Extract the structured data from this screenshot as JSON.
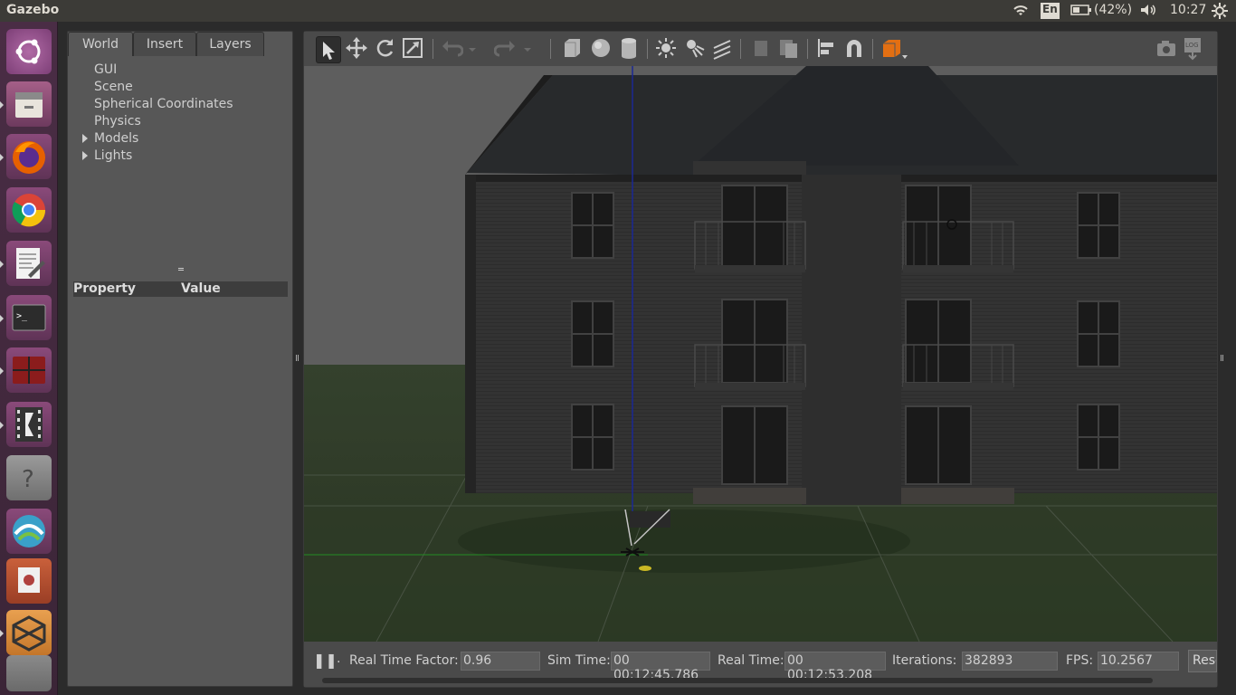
{
  "topbar": {
    "app_title": "Gazebo",
    "keyboard_layout": "En",
    "battery": "(42%)",
    "clock": "10:27"
  },
  "launcher": {
    "icons": [
      "ubuntu-dash-icon",
      "files-icon",
      "firefox-icon",
      "chrome-icon",
      "text-editor-icon",
      "terminal-icon",
      "terminator-icon",
      "video-editor-icon",
      "help-icon",
      "network-app-icon",
      "document-viewer-icon",
      "box-app-icon",
      "trash-icon"
    ]
  },
  "left_panel": {
    "tabs": [
      "World",
      "Insert",
      "Layers"
    ],
    "tree": [
      {
        "label": "GUI",
        "expandable": false
      },
      {
        "label": "Scene",
        "expandable": false
      },
      {
        "label": "Spherical Coordinates",
        "expandable": false
      },
      {
        "label": "Physics",
        "expandable": false
      },
      {
        "label": "Models",
        "expandable": true
      },
      {
        "label": "Lights",
        "expandable": true
      }
    ],
    "property_header": "Property",
    "value_header": "Value"
  },
  "toolbar": {
    "tools": [
      "select-mode-icon",
      "translate-mode-icon",
      "rotate-mode-icon",
      "scale-mode-icon",
      "undo-icon",
      "undo-dropdown-icon",
      "redo-icon",
      "redo-dropdown-icon",
      "box-shape-icon",
      "sphere-shape-icon",
      "cylinder-shape-icon",
      "point-light-icon",
      "spot-light-icon",
      "directional-light-icon",
      "copy-icon",
      "paste-icon",
      "align-icon",
      "snap-icon",
      "view-angle-icon",
      "screenshot-icon",
      "log-icon"
    ]
  },
  "bottombar": {
    "pause_glyph": "❚❚",
    "step_label": ".",
    "rtf_label": "Real Time Factor:",
    "rtf_value": "0.96",
    "sim_time_label": "Sim Time:",
    "sim_time_value": "00 00:12:45.786",
    "real_time_label": "Real Time:",
    "real_time_value": "00 00:12:53.208",
    "iterations_label": "Iterations:",
    "iterations_value": "382893",
    "fps_label": "FPS:",
    "fps_value": "10.2567",
    "reset_label": "Rese"
  },
  "colors": {
    "launcher_bg": "#4a2d45",
    "panel_bg": "#575757",
    "toolbar_bg": "#4a4a4a",
    "accent_orange": "#e36f12"
  }
}
